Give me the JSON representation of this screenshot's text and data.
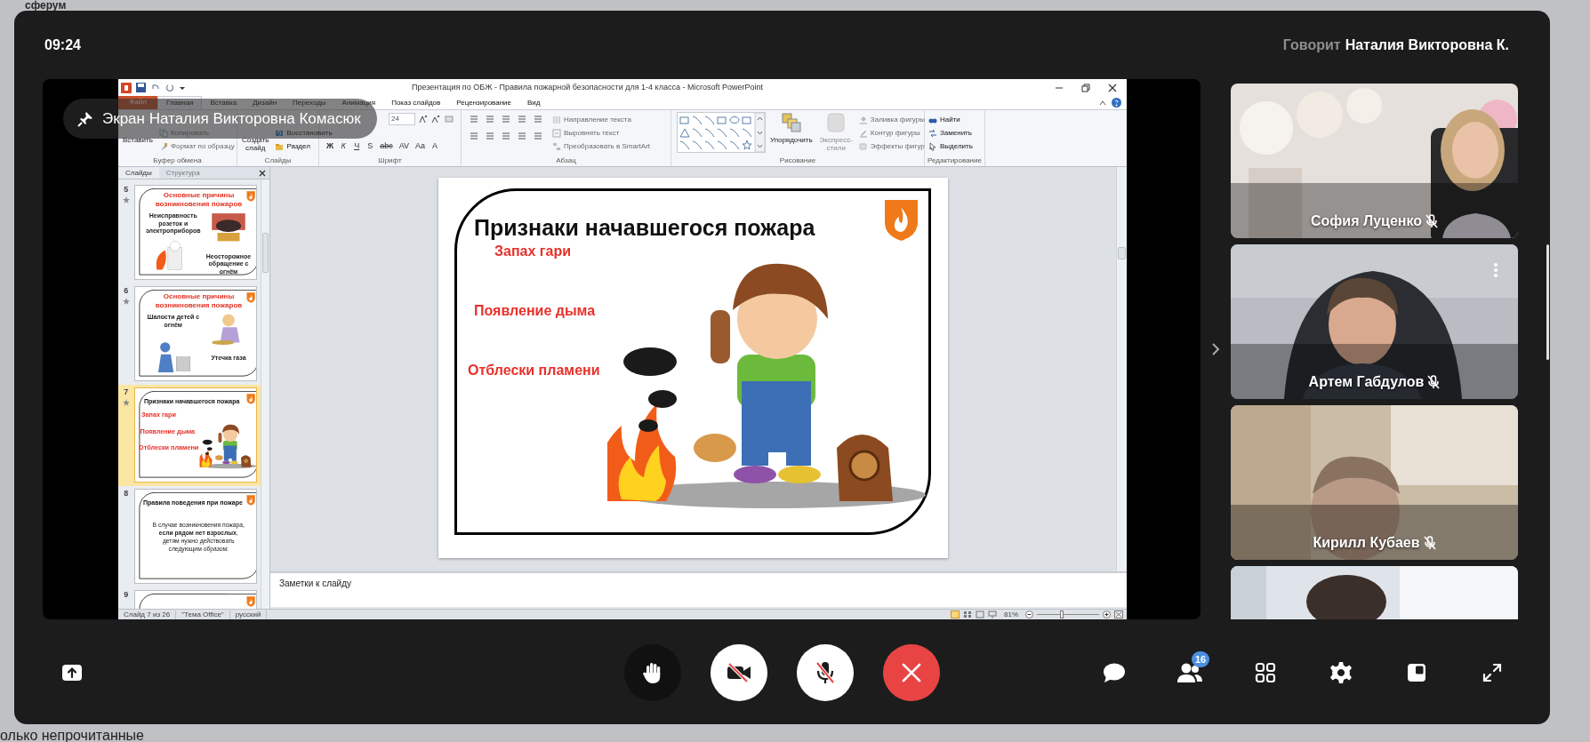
{
  "background_app": {
    "logo": "сферум",
    "filter_label": "олько непрочитанные"
  },
  "call": {
    "time": "09:24",
    "speaker": {
      "label": "Говорит",
      "name": "Наталия Викторовна К."
    },
    "screen_share": {
      "presenter_label": "Экран Наталия Викторовна Комасюк",
      "window": {
        "title": "Презентация по ОБЖ - Правила пожарной безопасности для 1-4 класса - Microsoft PowerPoint",
        "tabs": [
          {
            "label": "Файл",
            "kind": "file",
            "selected": false
          },
          {
            "label": "Главная",
            "kind": "tab",
            "selected": true
          },
          {
            "label": "Вставка",
            "kind": "tab",
            "selected": false
          },
          {
            "label": "Дизайн",
            "kind": "tab",
            "selected": false
          },
          {
            "label": "Переходы",
            "kind": "tab",
            "selected": false
          },
          {
            "label": "Анимация",
            "kind": "tab",
            "selected": false
          },
          {
            "label": "Показ слайдов",
            "kind": "tab",
            "selected": false
          },
          {
            "label": "Рецензирование",
            "kind": "tab",
            "selected": false
          },
          {
            "label": "Вид",
            "kind": "tab",
            "selected": false
          }
        ],
        "ribbon": [
          {
            "label": "Буфер обмена",
            "items": [
              {
                "kind": "big",
                "label": "Вставить",
                "disabled": false
              },
              {
                "kind": "small",
                "label": "Копировать",
                "disabled": true
              },
              {
                "kind": "small",
                "label": "Формат по образцу",
                "disabled": true
              }
            ]
          },
          {
            "label": "Слайды",
            "items": [
              {
                "kind": "big",
                "label": "Создать слайд",
                "disabled": false
              },
              {
                "kind": "small",
                "label": "Восстановить",
                "disabled": false
              },
              {
                "kind": "small",
                "label": "Раздел",
                "disabled": false
              }
            ]
          },
          {
            "label": "Шрифт",
            "items": [
              {
                "kind": "font",
                "size": "24",
                "buttons": [
                  "Ж",
                  "К",
                  "Ч",
                  "S",
                  "abc",
                  "AV",
                  "Aa",
                  "A"
                ]
              }
            ]
          },
          {
            "label": "Абзац",
            "items": [
              {
                "kind": "paragraph-tools"
              },
              {
                "kind": "small",
                "label": "Направление текста",
                "disabled": true
              },
              {
                "kind": "small",
                "label": "Выровнять текст",
                "disabled": true
              },
              {
                "kind": "small",
                "label": "Преобразовать в SmartArt",
                "disabled": true
              }
            ]
          },
          {
            "label": "Рисование",
            "items": [
              {
                "kind": "shapes"
              },
              {
                "kind": "big",
                "label": "Упорядочить",
                "disabled": false
              },
              {
                "kind": "big",
                "label": "Экспресс-стили",
                "disabled": true
              },
              {
                "kind": "small",
                "label": "Заливка фигуры",
                "disabled": true
              },
              {
                "kind": "small",
                "label": "Контур фигуры",
                "disabled": true
              },
              {
                "kind": "small",
                "label": "Эффекты фигур",
                "disabled": true
              }
            ]
          },
          {
            "label": "Редактирование",
            "items": [
              {
                "kind": "small",
                "label": "Найти",
                "disabled": false
              },
              {
                "kind": "small",
                "label": "Заменить",
                "disabled": false
              },
              {
                "kind": "small",
                "label": "Выделить",
                "disabled": false
              }
            ]
          }
        ],
        "pane_tabs": [
          {
            "label": "Слайды",
            "selected": true
          },
          {
            "label": "Структура",
            "selected": false
          }
        ],
        "slides": [
          {
            "number": "5",
            "kind": "causes",
            "animated": true,
            "selected": false,
            "title": "Основные причины возникновения пожаров",
            "texts": [
              "Неисправность розеток и электроприборов",
              "Неосторожное обращение с огнём"
            ]
          },
          {
            "number": "6",
            "kind": "causes",
            "animated": true,
            "selected": false,
            "title": "Основные причины возникновения пожаров",
            "texts": [
              "Шалости детей с огнём",
              "Утечка газа"
            ]
          },
          {
            "number": "7",
            "kind": "signs",
            "animated": true,
            "selected": true,
            "title": "Признаки начавшегося пожара",
            "texts": [
              "Запах гари",
              "Появление дыма",
              "Отблески пламени"
            ]
          },
          {
            "number": "8",
            "kind": "rules",
            "animated": false,
            "selected": false,
            "title": "Правила поведения при пожаре",
            "texts": [
              "В случае возникновения пожара, **если рядом нет взрослых**, детям нужно действовать следующим образом:"
            ]
          },
          {
            "number": "9",
            "kind": "partial",
            "animated": false,
            "selected": false
          }
        ],
        "current_slide": {
          "kind": "signs",
          "title": "Признаки начавшегося пожара",
          "texts": [
            "Запах гари",
            "Появление дыма",
            "Отблески пламени"
          ]
        },
        "notes": {
          "placeholder": "Заметки к слайду"
        },
        "status_bar": {
          "slide": "Слайд 7 из 26",
          "theme": "\"Тема Office\"",
          "language": "русский",
          "zoom": "81%",
          "level": 0.4
        }
      }
    },
    "participants": [
      {
        "name": "София Луценко",
        "mic_muted": true,
        "show_menu": false
      },
      {
        "name": "Артем Габдулов",
        "mic_muted": true,
        "show_menu": true
      },
      {
        "name": "Кирилл Кубаев",
        "mic_muted": true,
        "show_menu": false
      },
      {
        "show_menu": false
      }
    ],
    "controls": [
      {
        "kind": "hand",
        "on": false
      },
      {
        "kind": "camera",
        "on": false
      },
      {
        "kind": "mic",
        "on": false
      },
      {
        "kind": "leave"
      }
    ],
    "side_controls": [
      {
        "kind": "chat"
      },
      {
        "kind": "participants",
        "badge": "16"
      },
      {
        "kind": "layout"
      },
      {
        "kind": "settings"
      },
      {
        "kind": "pip"
      },
      {
        "kind": "fullscreen"
      }
    ]
  }
}
